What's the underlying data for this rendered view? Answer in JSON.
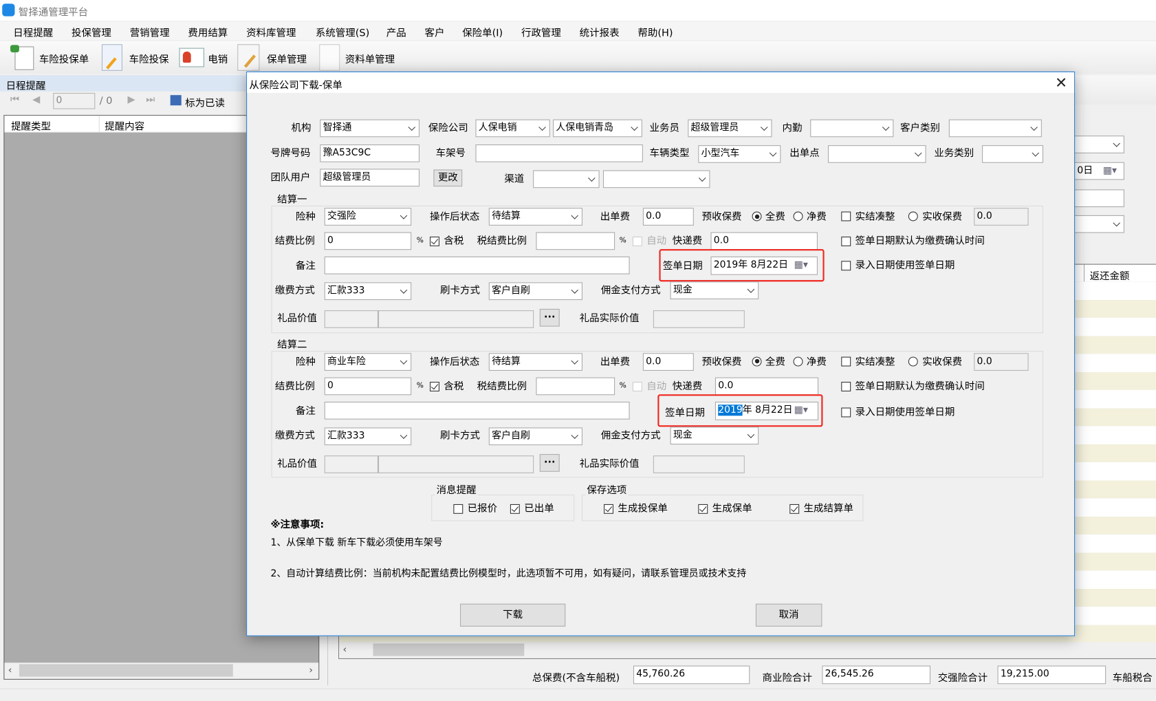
{
  "app": {
    "title": "智择通管理平台"
  },
  "menu": [
    "日程提醒",
    "投保管理",
    "营销管理",
    "费用结算",
    "资料库管理",
    "系统管理(S)",
    "产品",
    "客户",
    "保险单(I)",
    "行政管理",
    "统计报表",
    "帮助(H)"
  ],
  "toolbar": [
    "车险投保单",
    "车险投保",
    "电销",
    "保单管理",
    "资料单管理"
  ],
  "left_panel": {
    "title": "日程提醒",
    "page_value": "0",
    "page_total": "/ 0",
    "mark_read": "标为已读",
    "columns": [
      "提醒类型",
      "提醒内容"
    ]
  },
  "right_panel": {
    "date_partial": "0日",
    "column_return": "返还金额"
  },
  "summary": {
    "total_label": "总保费(不含车船税)",
    "total_value": "45,760.26",
    "commercial_label": "商业险合计",
    "commercial_value": "26,545.26",
    "compulsory_label": "交强险合计",
    "compulsory_value": "19,215.00",
    "vessel_tax_label": "车船税合"
  },
  "dialog": {
    "title": "从保险公司下载-保单",
    "org_label": "机构",
    "org": "智择通",
    "insurer_label": "保险公司",
    "insurer": "人保电销",
    "insurer_branch": "人保电销青岛",
    "salesman_label": "业务员",
    "salesman": "超级管理员",
    "internal_label": "内勤",
    "internal": "",
    "customer_type_label": "客户类别",
    "customer_type": "",
    "plate_label": "号牌号码",
    "plate": "豫A53C9C",
    "vin_label": "车架号",
    "vin": "",
    "vehicle_type_label": "车辆类型",
    "vehicle_type": "小型汽车",
    "issue_point_label": "出单点",
    "issue_point": "",
    "biz_type_label": "业务类别",
    "biz_type": "",
    "team_user_label": "团队用户",
    "team_user": "超级管理员",
    "change_button": "更改",
    "channel_label": "渠道",
    "settlements": [
      {
        "title": "结算一",
        "insurance_type": "交强险",
        "status": "待结算",
        "issue_fee": "0.0",
        "fee_ratio": "0",
        "tax_fee_ratio": "",
        "express_fee": "0.0",
        "remark": "",
        "sign_date": "2019年 8月22日",
        "pay_method": "汇款333",
        "card_method": "客户自刷",
        "commission_method": "现金",
        "actual_premium": "0.0",
        "tax_included": true,
        "auto": false,
        "premium_mode": "全费",
        "round_off": false,
        "default_pay_confirm": false,
        "entry_use_sign_date": false
      },
      {
        "title": "结算二",
        "insurance_type": "商业车险",
        "status": "待结算",
        "issue_fee": "0.0",
        "fee_ratio": "0",
        "tax_fee_ratio": "",
        "express_fee": "0.0",
        "remark": "",
        "sign_date_year": "2019",
        "sign_date_rest": "年  8月22日",
        "pay_method": "汇款333",
        "card_method": "客户自刷",
        "commission_method": "现金",
        "actual_premium": "0.0",
        "tax_included": true,
        "auto": false,
        "premium_mode": "全费",
        "round_off": false,
        "default_pay_confirm": false,
        "entry_use_sign_date": false
      }
    ],
    "labels": {
      "insurance_type": "险种",
      "status": "操作后状态",
      "issue_fee": "出单费",
      "prepaid": "预收保费",
      "full": "全费",
      "net": "净费",
      "round_off": "实结凑整",
      "actual_premium": "实收保费",
      "fee_ratio": "结费比例",
      "percent": "%",
      "tax_included": "含税",
      "tax_fee_ratio": "税结费比例",
      "auto": "自动",
      "express_fee": "快递费",
      "default_pay_confirm": "签单日期默认为缴费确认时间",
      "remark": "备注",
      "sign_date": "签单日期",
      "entry_use_sign_date": "录入日期使用签单日期",
      "pay_method": "缴费方式",
      "card_method": "刷卡方式",
      "commission_method": "佣金支付方式",
      "gift_value": "礼品价值",
      "gift_actual": "礼品实际价值",
      "ellipsis": "···"
    },
    "message_group": {
      "title": "消息提醒",
      "quoted": "已报价",
      "issued": "已出单"
    },
    "save_group": {
      "title": "保存选项",
      "gen_proposal": "生成投保单",
      "gen_policy": "生成保单",
      "gen_settlement": "生成结算单"
    },
    "notes_title": "※注意事项:",
    "note1": "1、从保单下载 新车下载必须使用车架号",
    "note2": "2、自动计算结费比例：当前机构未配置结费比例模型时，此选项暂不可用，如有疑问，请联系管理员或技术支持",
    "download_button": "下载",
    "cancel_button": "取消"
  }
}
